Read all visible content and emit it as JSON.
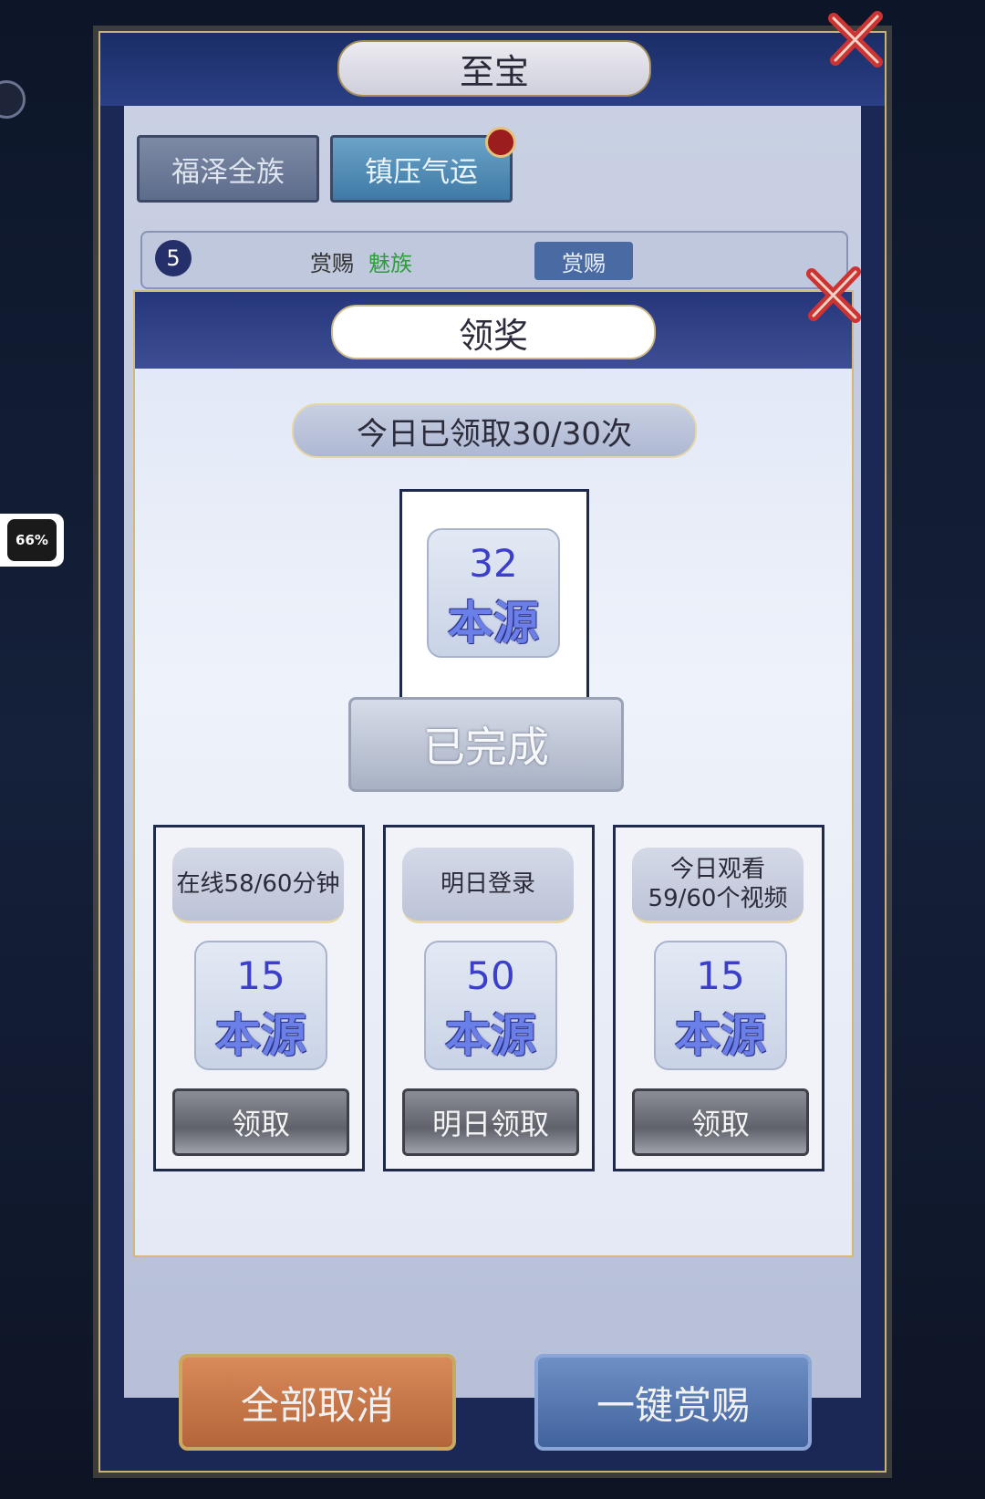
{
  "hud": {
    "fps_badge": "66%"
  },
  "treasure_panel": {
    "title": "至宝",
    "tabs": [
      {
        "label": "福泽全族"
      },
      {
        "label": "镇压气运"
      }
    ],
    "row": {
      "rank": "5",
      "label": "赏赐",
      "highlight": "魅族",
      "button": "赏赐"
    },
    "footer": {
      "cancel_all": "全部取消",
      "one_click_reward": "一键赏赐"
    }
  },
  "reward_dialog": {
    "title": "领奖",
    "daily_count": "今日已领取30/30次",
    "main_reward": {
      "amount": "32",
      "name": "本源"
    },
    "status_button": "已完成",
    "tasks": [
      {
        "condition": "在线58/60分钟",
        "amount": "15",
        "name": "本源",
        "action": "领取"
      },
      {
        "condition": "明日登录",
        "amount": "50",
        "name": "本源",
        "action": "明日领取"
      },
      {
        "condition": "今日观看\n59/60个视频",
        "amount": "15",
        "name": "本源",
        "action": "领取"
      }
    ]
  },
  "colors": {
    "panel_navy": "#1b2856",
    "gold_trim": "#c9b27a",
    "reward_number": "#3b3fc9"
  }
}
